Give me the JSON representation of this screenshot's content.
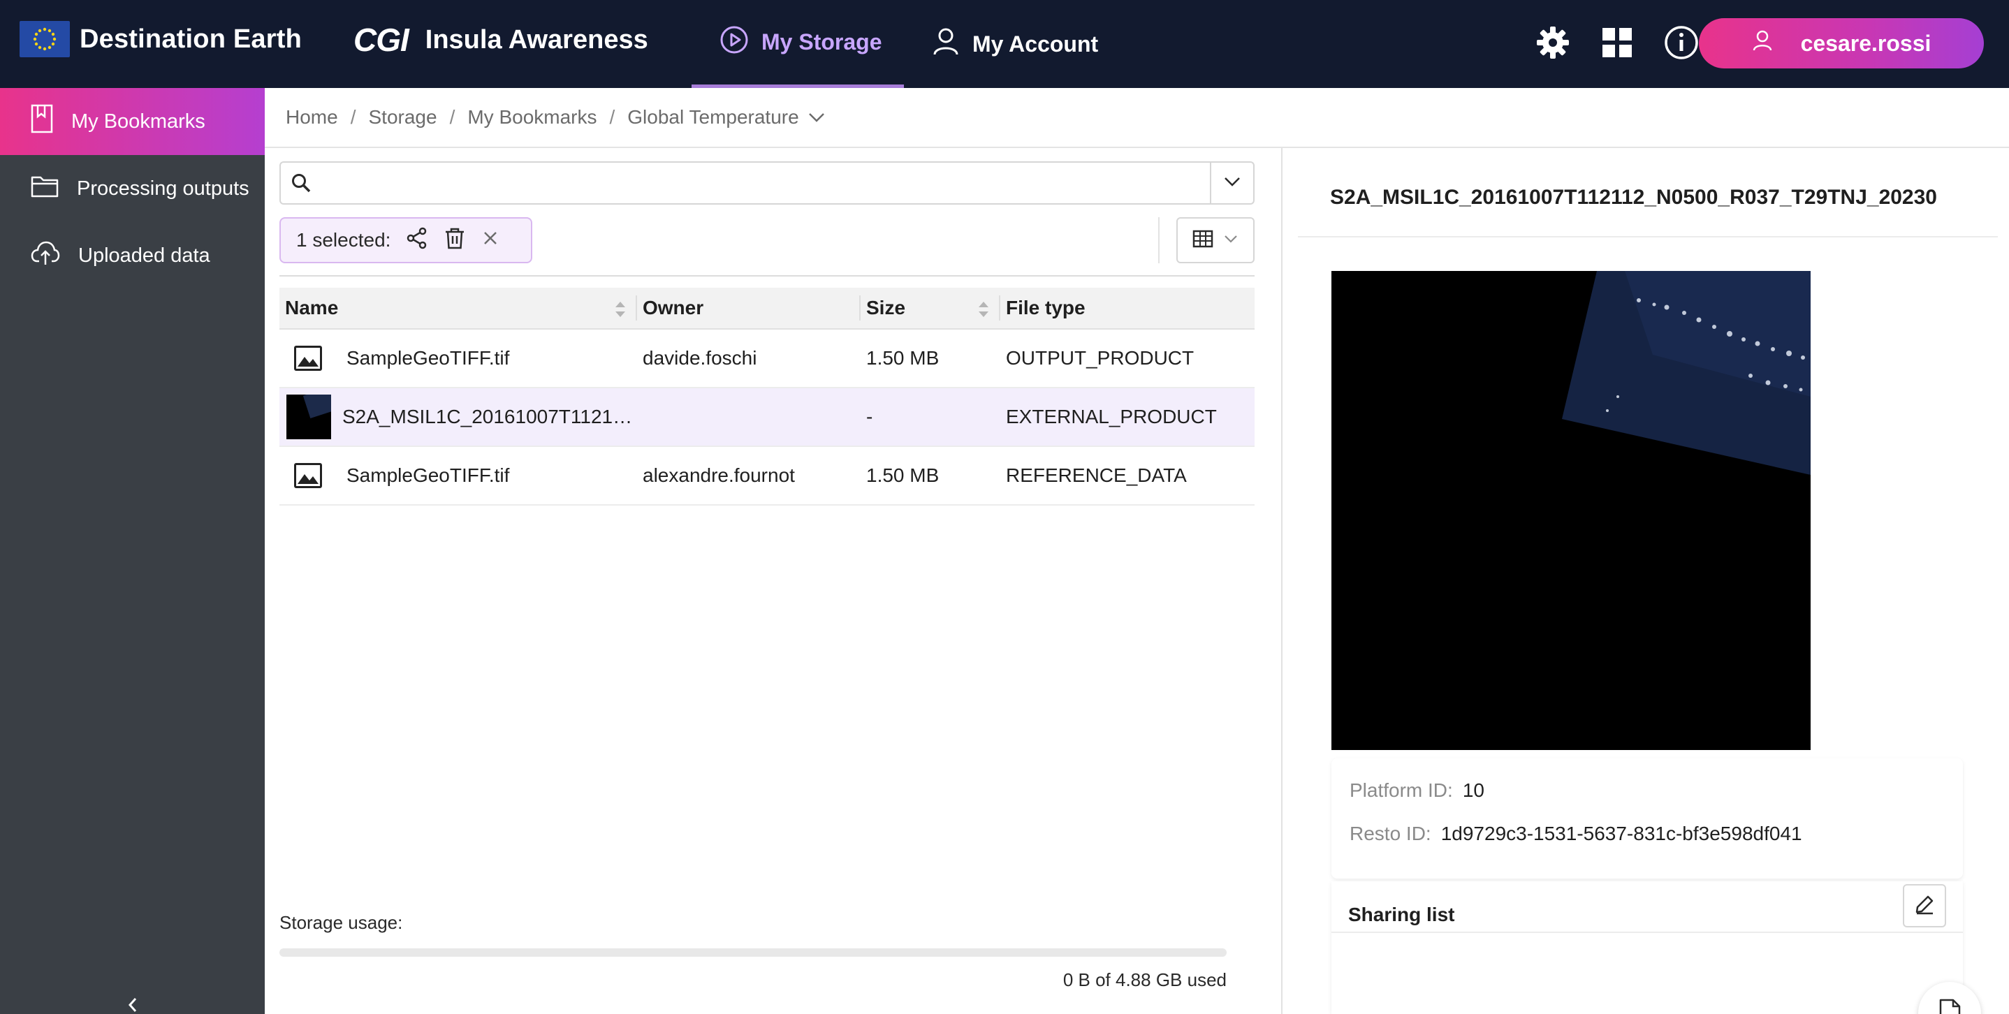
{
  "header": {
    "brand_title": "Destination Earth",
    "cgi_logo": "CGI",
    "app_title": "Insula Awareness",
    "nav": [
      {
        "label": "My Storage",
        "icon": "play-circle-icon",
        "active": true
      },
      {
        "label": "My Account",
        "icon": "user-icon",
        "active": false
      }
    ],
    "icons": [
      "gear-icon",
      "apps-grid-icon",
      "info-icon"
    ],
    "user": {
      "name": "cesare.rossi",
      "icon": "user-icon"
    }
  },
  "sidebar": {
    "items": [
      {
        "label": "My Bookmarks",
        "icon": "bookmark-icon",
        "active": true
      },
      {
        "label": "Processing outputs",
        "icon": "folder-icon",
        "active": false
      },
      {
        "label": "Uploaded data",
        "icon": "cloud-upload-icon",
        "active": false
      }
    ],
    "collapse_icon": "chevron-left-icon"
  },
  "breadcrumb": {
    "items": [
      "Home",
      "Storage",
      "My Bookmarks",
      "Global Temperature"
    ],
    "separator": "/"
  },
  "search": {
    "value": "",
    "placeholder": ""
  },
  "selection": {
    "label": "1 selected:",
    "actions": [
      "share-icon",
      "trash-icon",
      "close-icon"
    ]
  },
  "view_toggle": {
    "icon": "table-view-icon"
  },
  "table": {
    "columns": [
      "Name",
      "Owner",
      "Size",
      "File type"
    ],
    "rows": [
      {
        "name": "SampleGeoTIFF.tif",
        "owner": "davide.foschi",
        "size": "1.50 MB",
        "type": "OUTPUT_PRODUCT",
        "icon": "image-icon",
        "selected": false
      },
      {
        "name": "S2A_MSIL1C_20161007T1121…",
        "owner": "",
        "size": "-",
        "type": "EXTERNAL_PRODUCT",
        "icon": "thumbnail",
        "selected": true
      },
      {
        "name": "SampleGeoTIFF.tif",
        "owner": "alexandre.fournot",
        "size": "1.50 MB",
        "type": "REFERENCE_DATA",
        "icon": "image-icon",
        "selected": false
      }
    ]
  },
  "storage": {
    "label": "Storage usage:",
    "used_text": "0 B of 4.88 GB used",
    "used_fraction": 0
  },
  "details": {
    "title": "S2A_MSIL1C_20161007T112112_N0500_R037_T29TNJ_20230",
    "platform_id_label": "Platform ID:",
    "platform_id": "10",
    "resto_id_label": "Resto ID:",
    "resto_id": "1d9729c3-1531-5637-831c-bf3e598df041",
    "sharing_title": "Sharing list"
  },
  "colors": {
    "topbar": "#121a2f",
    "accent_gradient_start": "#e8338b",
    "accent_gradient_end": "#a53fd3",
    "active_nav": "#c8a6ff",
    "sidebar": "#3a3f45"
  }
}
